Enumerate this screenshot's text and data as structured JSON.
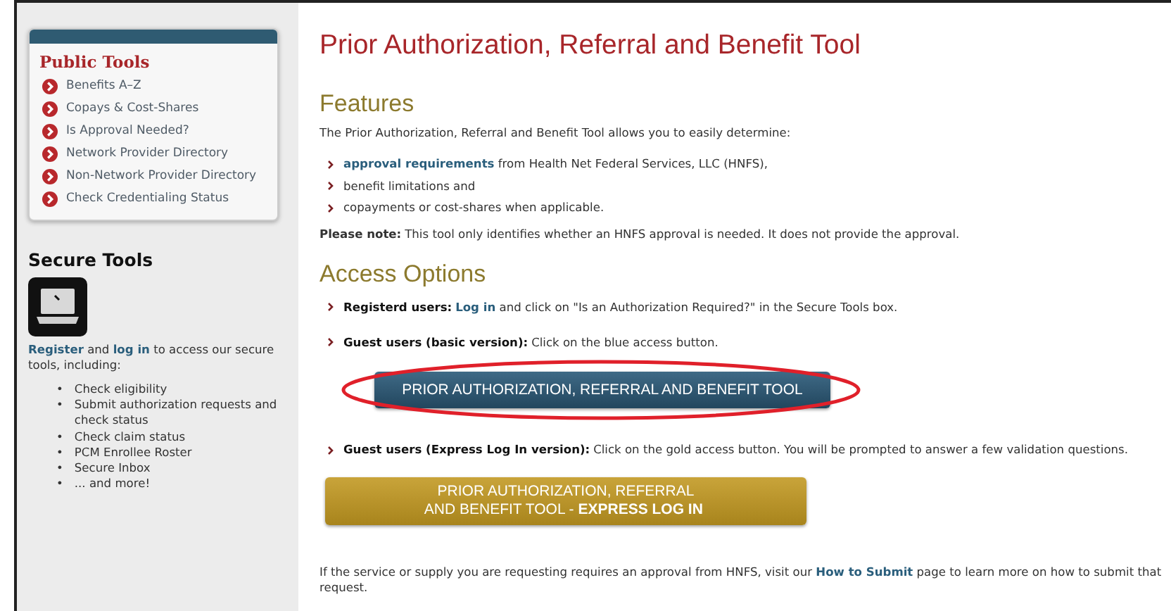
{
  "sidebar": {
    "public_tools": {
      "title": "Public Tools",
      "items": [
        "Benefits A–Z",
        "Copays & Cost-Shares",
        "Is Approval Needed?",
        "Network Provider Directory",
        "Non-Network Provider Directory",
        "Check Credentialing Status"
      ]
    },
    "secure_tools": {
      "title": "Secure Tools",
      "intro": [
        {
          "kind": "link",
          "text": "Register"
        },
        {
          "kind": "plain",
          "text": " and "
        },
        {
          "kind": "link",
          "text": "log in"
        },
        {
          "kind": "plain",
          "text": " to access our secure tools, including:"
        }
      ],
      "items": [
        {
          "bullet": "•",
          "text": "Check eligibility"
        },
        {
          "bullet": "•",
          "text": "Submit authorization requests and check status"
        },
        {
          "bullet": "•",
          "text": "Check claim status"
        },
        {
          "bullet": "•",
          "text": "PCM Enrollee Roster"
        },
        {
          "bullet": "•",
          "text": "Secure Inbox"
        },
        {
          "bullet": "•",
          "text": "... and more!"
        }
      ]
    }
  },
  "main": {
    "title": "Prior Authorization, Referral and Benefit Tool",
    "features": {
      "heading": "Features",
      "intro": "The Prior Authorization, Referral and Benefit Tool allows you to easily determine:",
      "bullets": [
        [
          {
            "kind": "link",
            "text": "approval requirements"
          },
          {
            "kind": "plain",
            "text": " from Health Net Federal Services, LLC (HNFS),"
          }
        ],
        [
          {
            "kind": "plain",
            "text": "benefit limitations and"
          }
        ],
        [
          {
            "kind": "plain",
            "text": "copayments or cost-shares when applicable."
          }
        ]
      ],
      "note": [
        {
          "kind": "bold",
          "text": "Please note:"
        },
        {
          "kind": "plain",
          "text": "This tool only identifies whether an HNFS approval is needed. It does not provide the approval."
        }
      ]
    },
    "access": {
      "heading": "Access Options",
      "items": [
        {
          "kind": "option",
          "segments": [
            {
              "kind": "bold",
              "text": "Registerd users:"
            },
            {
              "kind": "link",
              "text": "Log in"
            },
            {
              "kind": "plain",
              "text": " and click on \"Is an Authorization Required?\" in the Secure Tools box."
            }
          ]
        },
        {
          "kind": "option",
          "segments": [
            {
              "kind": "bold",
              "text": "Guest users (basic version):"
            },
            {
              "kind": "plain",
              "text": "Click on the blue access button."
            }
          ]
        },
        {
          "kind": "basic_button",
          "highlighted": true,
          "lines": [
            "PRIOR AUTHORIZATION, REFERRAL  AND BENEFIT TOOL"
          ]
        },
        {
          "kind": "option",
          "segments": [
            {
              "kind": "bold",
              "text": "Guest users (Express Log In version):"
            },
            {
              "kind": "plain",
              "text": "Click on the gold access button. You will be prompted to answer a few validation questions."
            }
          ]
        },
        {
          "kind": "express_button",
          "highlighted": false,
          "lines": [
            "PRIOR AUTHORIZATION, REFERRAL",
            "AND BENEFIT TOOL - **EXPRESS LOG IN**"
          ]
        }
      ]
    },
    "footer": [
      {
        "kind": "plain",
        "text": "If the service or supply you are requesting requires an approval from HNFS, visit our "
      },
      {
        "kind": "link",
        "text": "How to Submit"
      },
      {
        "kind": "plain",
        "text": " page to learn more on how to submit that request."
      }
    ]
  }
}
